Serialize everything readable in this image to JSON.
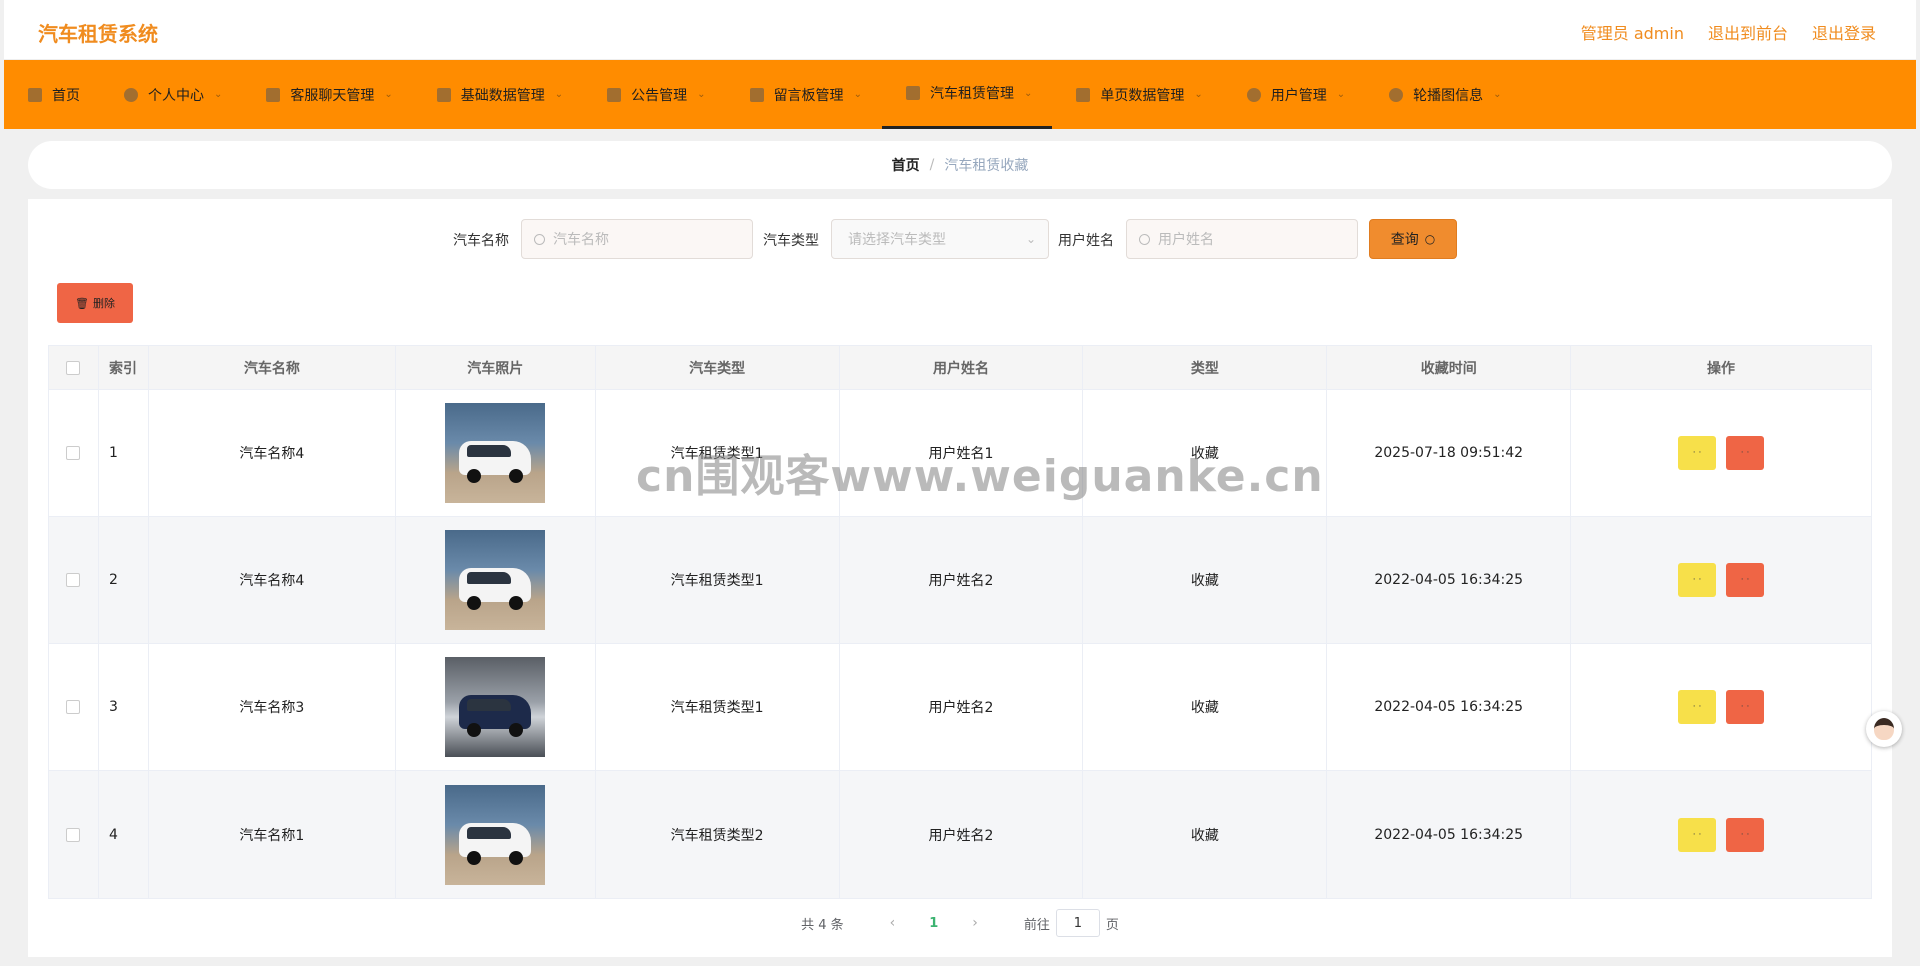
{
  "header": {
    "brand": "汽车租赁系统",
    "user_label": "管理员 admin",
    "back_to_front": "退出到前台",
    "logout": "退出登录"
  },
  "nav": [
    {
      "label": "首页",
      "icon": "home-icon"
    },
    {
      "label": "个人中心",
      "icon": "user-icon"
    },
    {
      "label": "客服聊天管理",
      "icon": "chat-icon"
    },
    {
      "label": "基础数据管理",
      "icon": "grid-icon"
    },
    {
      "label": "公告管理",
      "icon": "apps-icon"
    },
    {
      "label": "留言板管理",
      "icon": "message-icon"
    },
    {
      "label": "汽车租赁管理",
      "icon": "send-icon"
    },
    {
      "label": "单页数据管理",
      "icon": "car-icon"
    },
    {
      "label": "用户管理",
      "icon": "clock-icon"
    },
    {
      "label": "轮播图信息",
      "icon": "person-icon"
    }
  ],
  "breadcrumb": {
    "home": "首页",
    "separator": "/",
    "current": "汽车租赁收藏"
  },
  "search": {
    "car_name_label": "汽车名称",
    "car_name_placeholder": "汽车名称",
    "car_type_label": "汽车类型",
    "car_type_placeholder": "请选择汽车类型",
    "user_name_label": "用户姓名",
    "user_name_placeholder": "用户姓名",
    "query_button": "查询"
  },
  "actions": {
    "delete_button": "删除"
  },
  "table": {
    "headers": [
      "索引",
      "汽车名称",
      "汽车照片",
      "汽车类型",
      "用户姓名",
      "类型",
      "收藏时间",
      "操作"
    ],
    "rows": [
      {
        "index": "1",
        "car_name": "汽车名称4",
        "car_type": "汽车租赁类型1",
        "user_name": "用户姓名1",
        "kind": "收藏",
        "time": "2025-07-18 09:51:42",
        "photo": "white-van"
      },
      {
        "index": "2",
        "car_name": "汽车名称4",
        "car_type": "汽车租赁类型1",
        "user_name": "用户姓名2",
        "kind": "收藏",
        "time": "2022-04-05 16:34:25",
        "photo": "white-van"
      },
      {
        "index": "3",
        "car_name": "汽车名称3",
        "car_type": "汽车租赁类型1",
        "user_name": "用户姓名2",
        "kind": "收藏",
        "time": "2022-04-05 16:34:25",
        "photo": "dark-suv"
      },
      {
        "index": "4",
        "car_name": "汽车名称1",
        "car_type": "汽车租赁类型2",
        "user_name": "用户姓名2",
        "kind": "收藏",
        "time": "2022-04-05 16:34:25",
        "photo": "white-van"
      }
    ]
  },
  "pagination": {
    "total": "共 4 条",
    "current_page": "1",
    "goto_label": "前往",
    "goto_value": "1",
    "page_suffix": "页"
  },
  "watermark": "cn围观客www.weiguanke.cn",
  "colors": {
    "nav_bg": "#ff8c00",
    "brand": "#f08c1f",
    "delete": "#ef6545",
    "edit": "#f7e04a",
    "query": "#f08c2e"
  }
}
